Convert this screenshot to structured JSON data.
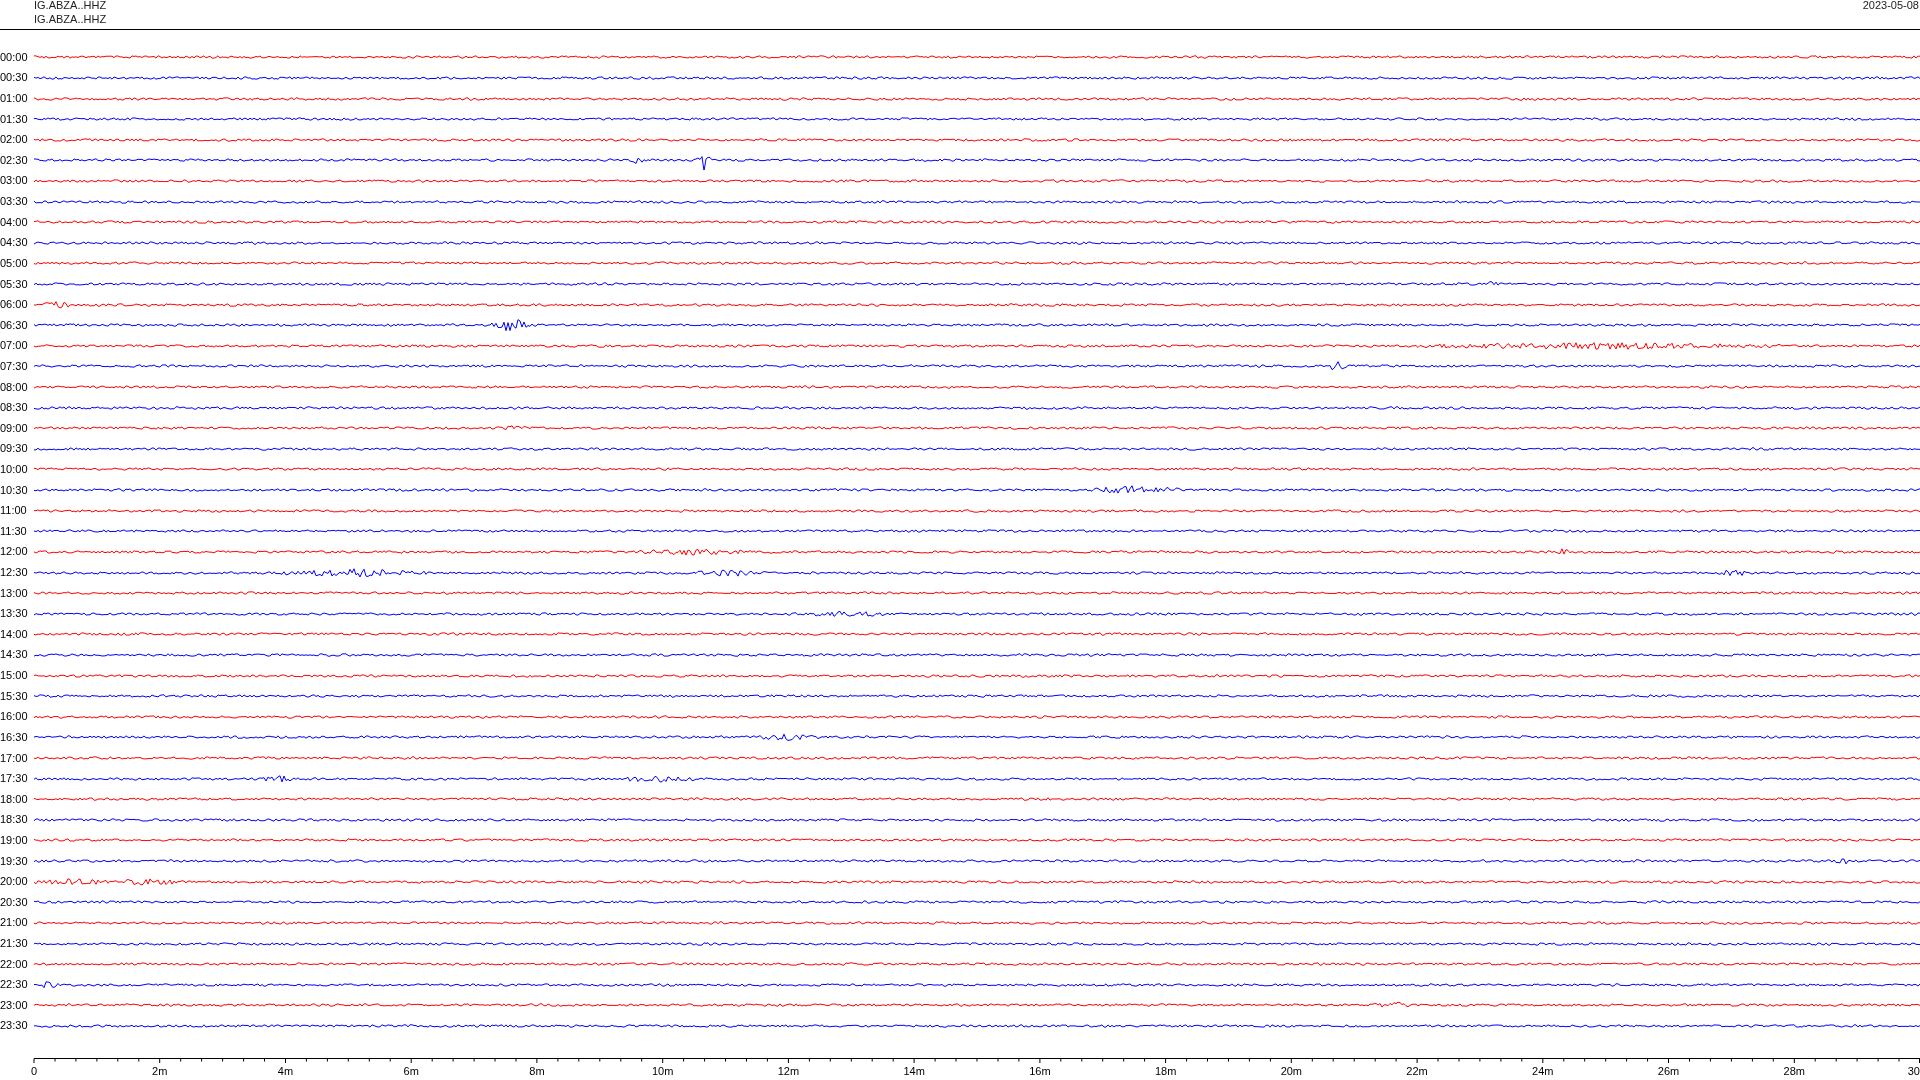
{
  "header": {
    "channel_lines": [
      "IG.ABZA..HHZ",
      "IG.ABZA..HHZ"
    ],
    "date": "2023-05-08"
  },
  "rows": [
    {
      "time": "00:00",
      "color": "#ff0000"
    },
    {
      "time": "00:30",
      "color": "#0000ff"
    },
    {
      "time": "01:00",
      "color": "#ff0000"
    },
    {
      "time": "01:30",
      "color": "#0000ff"
    },
    {
      "time": "02:00",
      "color": "#ff0000"
    },
    {
      "time": "02:30",
      "color": "#0000ff"
    },
    {
      "time": "03:00",
      "color": "#ff0000"
    },
    {
      "time": "03:30",
      "color": "#0000ff"
    },
    {
      "time": "04:00",
      "color": "#ff0000"
    },
    {
      "time": "04:30",
      "color": "#0000ff"
    },
    {
      "time": "05:00",
      "color": "#ff0000"
    },
    {
      "time": "05:30",
      "color": "#0000ff"
    },
    {
      "time": "06:00",
      "color": "#ff0000"
    },
    {
      "time": "06:30",
      "color": "#0000ff"
    },
    {
      "time": "07:00",
      "color": "#ff0000"
    },
    {
      "time": "07:30",
      "color": "#0000ff"
    },
    {
      "time": "08:00",
      "color": "#ff0000"
    },
    {
      "time": "08:30",
      "color": "#0000ff"
    },
    {
      "time": "09:00",
      "color": "#ff0000"
    },
    {
      "time": "09:30",
      "color": "#0000ff"
    },
    {
      "time": "10:00",
      "color": "#ff0000"
    },
    {
      "time": "10:30",
      "color": "#0000ff"
    },
    {
      "time": "11:00",
      "color": "#ff0000"
    },
    {
      "time": "11:30",
      "color": "#0000ff"
    },
    {
      "time": "12:00",
      "color": "#ff0000"
    },
    {
      "time": "12:30",
      "color": "#0000ff"
    },
    {
      "time": "13:00",
      "color": "#ff0000"
    },
    {
      "time": "13:30",
      "color": "#0000ff"
    },
    {
      "time": "14:00",
      "color": "#ff0000"
    },
    {
      "time": "14:30",
      "color": "#0000ff"
    },
    {
      "time": "15:00",
      "color": "#ff0000"
    },
    {
      "time": "15:30",
      "color": "#0000ff"
    },
    {
      "time": "16:00",
      "color": "#ff0000"
    },
    {
      "time": "16:30",
      "color": "#0000ff"
    },
    {
      "time": "17:00",
      "color": "#ff0000"
    },
    {
      "time": "17:30",
      "color": "#0000ff"
    },
    {
      "time": "18:00",
      "color": "#ff0000"
    },
    {
      "time": "18:30",
      "color": "#0000ff"
    },
    {
      "time": "19:00",
      "color": "#ff0000"
    },
    {
      "time": "19:30",
      "color": "#0000ff"
    },
    {
      "time": "20:00",
      "color": "#ff0000"
    },
    {
      "time": "20:30",
      "color": "#0000ff"
    },
    {
      "time": "21:00",
      "color": "#ff0000"
    },
    {
      "time": "21:30",
      "color": "#0000ff"
    },
    {
      "time": "22:00",
      "color": "#ff0000"
    },
    {
      "time": "22:30",
      "color": "#0000ff"
    },
    {
      "time": "23:00",
      "color": "#ff0000"
    },
    {
      "time": "23:30",
      "color": "#0000ff"
    }
  ],
  "axis": {
    "ticks": [
      "0",
      "2m",
      "4m",
      "6m",
      "8m",
      "10m",
      "12m",
      "14m",
      "16m",
      "18m",
      "20m",
      "22m",
      "24m",
      "26m",
      "28m",
      "30"
    ]
  }
}
